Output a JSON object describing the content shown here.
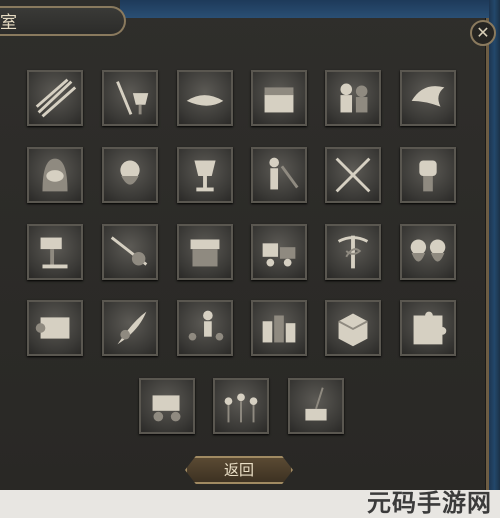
{
  "window": {
    "title": "室",
    "close_label": "✕"
  },
  "grid": {
    "rows": [
      [
        "arrows-bundle-icon",
        "sword-goblet-icon",
        "handshake-icon",
        "treasure-chest-icon",
        "armored-knights-icon",
        "dove-icon"
      ],
      [
        "hooded-mask-icon",
        "bearded-man-icon",
        "chalice-icon",
        "scales-figure-icon",
        "crossed-blades-icon",
        "raised-fist-icon"
      ],
      [
        "gavel-icon",
        "sword-grip-icon",
        "printing-press-icon",
        "cart-crates-icon",
        "caduceus-icon",
        "facing-heads-icon"
      ],
      [
        "scroll-map-icon",
        "feather-seal-icon",
        "preacher-crowd-icon",
        "city-buildings-icon",
        "wooden-crate-icon",
        "puzzle-piece-icon"
      ],
      [
        "carriage-icon",
        "raised-hands-crowd-icon",
        "inkwell-icon"
      ]
    ]
  },
  "footer": {
    "back_label": "返回"
  },
  "watermark": "元码手游网"
}
